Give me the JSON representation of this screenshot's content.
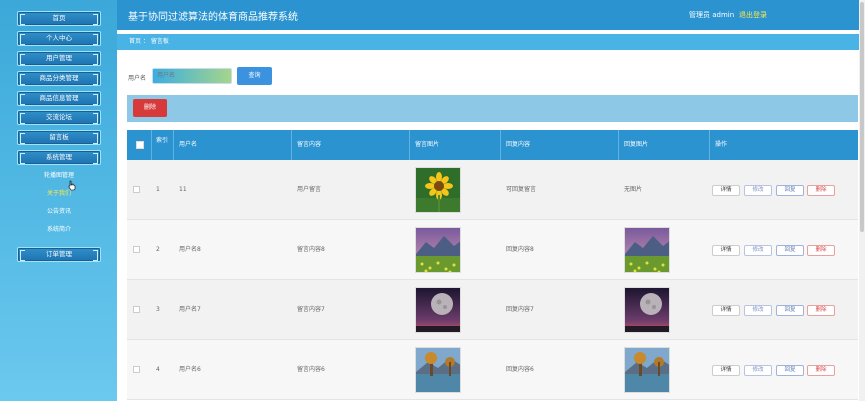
{
  "header": {
    "title": "基于协同过滤算法的体育商品推荐系统",
    "user_text": "管理员 admin",
    "logout_label": "退出登录"
  },
  "sidebar": {
    "menu": [
      "首页",
      "个人中心",
      "用户管理",
      "商品分类管理",
      "商品信息管理",
      "交流论坛",
      "留言板",
      "系统管理"
    ],
    "submenu": [
      "轮播图管理",
      "关于我们",
      "公告资讯",
      "系统简介"
    ],
    "order_menu": "订单管理"
  },
  "breadcrumb": "首页  ：  留言板",
  "search": {
    "label": "用户名",
    "placeholder": "用户名",
    "button_label": "查询"
  },
  "action_bar": {
    "delete_label": "删除"
  },
  "table": {
    "headers": [
      "索引",
      "用户名",
      "留言内容",
      "留言图片",
      "回复内容",
      "回复图片",
      "操作"
    ],
    "rows": [
      {
        "index": "1",
        "username": "11",
        "content": "用户留言",
        "reply": "可回复留言",
        "reply_image_text": "无图片",
        "image": "sunflower"
      },
      {
        "index": "2",
        "username": "用户名8",
        "content": "留言内容8",
        "reply": "回复内容8",
        "reply_image_text": "",
        "image": "mountain-field"
      },
      {
        "index": "3",
        "username": "用户名7",
        "content": "留言内容7",
        "reply": "回复内容7",
        "reply_image_text": "",
        "image": "moon-night"
      },
      {
        "index": "4",
        "username": "用户名6",
        "content": "留言内容6",
        "reply": "回复内容6",
        "reply_image_text": "",
        "image": "lake-trees"
      }
    ],
    "actions": {
      "detail": "详情",
      "edit": "修改",
      "reply": "回复",
      "delete": "删除"
    }
  },
  "colors": {
    "header": "#2a93d0",
    "sidebar": "#3ba8d9",
    "delete": "#d73a3a",
    "search_button": "#3b93e0"
  }
}
